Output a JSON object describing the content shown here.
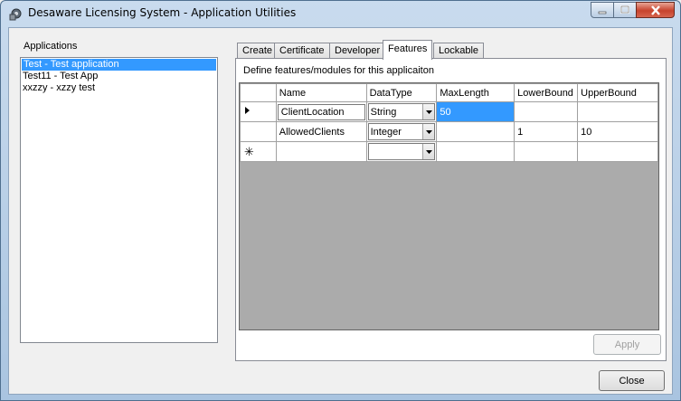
{
  "window": {
    "title": "Desaware Licensing System - Application Utilities",
    "icon": "lock-gear-icon"
  },
  "applications": {
    "label": "Applications",
    "items": [
      {
        "label": "Test - Test application",
        "selected": true
      },
      {
        "label": "Test11 - Test App",
        "selected": false
      },
      {
        "label": "xxzzy - xzzy test",
        "selected": false
      }
    ]
  },
  "tabs": [
    {
      "label": "Create",
      "active": false
    },
    {
      "label": "Certificate",
      "active": false
    },
    {
      "label": "Developer",
      "active": false
    },
    {
      "label": "Features",
      "active": true
    },
    {
      "label": "Lockable",
      "active": false
    }
  ],
  "features": {
    "description": "Define features/modules for this applicaiton",
    "columns": [
      "Name",
      "DataType",
      "MaxLength",
      "LowerBound",
      "UpperBound"
    ],
    "rows": [
      {
        "indicator": "current",
        "name": "ClientLocation",
        "datatype": "String",
        "maxlength": "50",
        "lowerbound": "",
        "upperbound": ""
      },
      {
        "indicator": "",
        "name": "AllowedClients",
        "datatype": "Integer",
        "maxlength": "",
        "lowerbound": "1",
        "upperbound": "10"
      },
      {
        "indicator": "new",
        "name": "",
        "datatype": "",
        "maxlength": "",
        "lowerbound": "",
        "upperbound": ""
      }
    ],
    "new_row_glyph": "✳",
    "apply_label": "Apply"
  },
  "footer": {
    "close_label": "Close"
  },
  "colors": {
    "selection": "#3399ff",
    "grid_background": "#ababab"
  }
}
